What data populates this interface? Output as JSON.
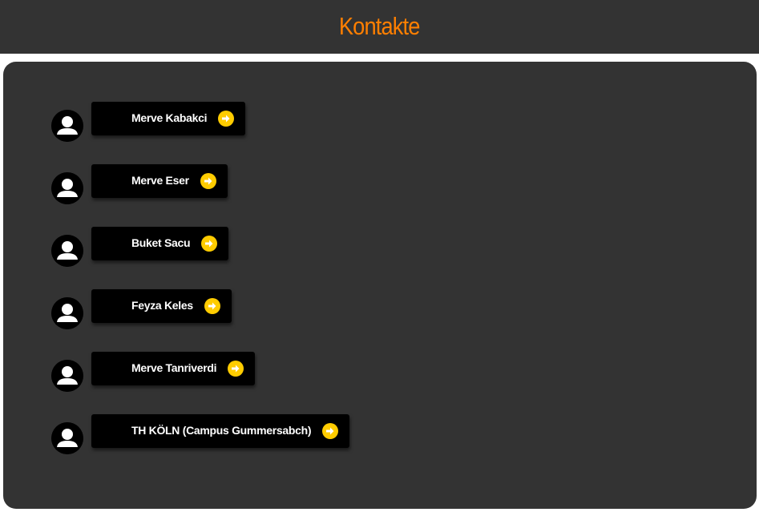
{
  "header": {
    "title": "Kontakte"
  },
  "colors": {
    "title_accent": "#ff7f00",
    "background": "#333333",
    "button": "#000000",
    "arrow": "#ffcc00"
  },
  "icons": {
    "avatar": "person-silhouette-icon",
    "go": "arrow-right-circle-icon"
  },
  "contacts": [
    {
      "name": "Merve Kabakci"
    },
    {
      "name": "Merve Eser"
    },
    {
      "name": "Buket Sacu"
    },
    {
      "name": "Feyza Keles"
    },
    {
      "name": "Merve Tanriverdi"
    },
    {
      "name": "TH KÖLN (Campus Gummersabch)"
    }
  ]
}
